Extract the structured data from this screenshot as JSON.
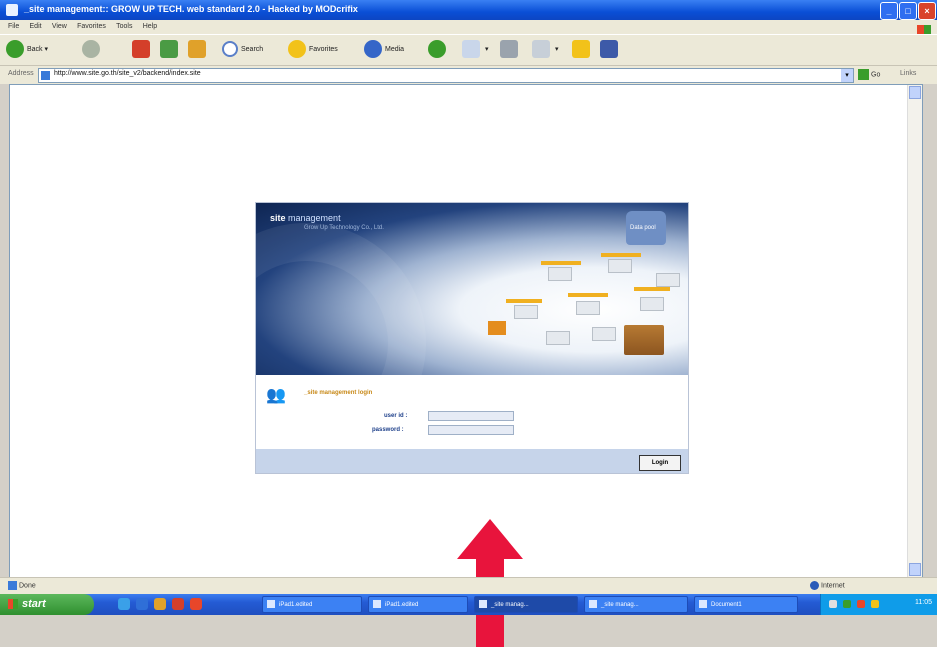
{
  "window": {
    "title": "_site management:: GROW UP TECH. web standard 2.0 - Hacked by MODcrifix"
  },
  "menu": [
    "File",
    "Edit",
    "View",
    "Favorites",
    "Tools",
    "Help"
  ],
  "toolbar": {
    "back": "Back",
    "search": "Search",
    "favorites": "Favorites",
    "media": "Media"
  },
  "address": {
    "label": "Address",
    "url": "http://www.site.go.th/site_v2/backend/index.site",
    "go": "Go",
    "links": "Links"
  },
  "banner": {
    "brand": "site",
    "brand_suffix": "management",
    "subtitle": "Grow Up Technology Co., Ltd.",
    "db_label": "Data pool"
  },
  "login": {
    "title": "_site management login",
    "user_label": "user id :",
    "password_label": "password :",
    "user_value": "",
    "password_value": "",
    "button": "Login"
  },
  "status": {
    "text": "Done",
    "zone": "Internet"
  },
  "taskbar": {
    "start": "start",
    "tasks": [
      "iPad1.edited",
      "iPad1.edited",
      "_site manag...",
      "_site manag...",
      "Document1"
    ],
    "clock": "11:05"
  }
}
